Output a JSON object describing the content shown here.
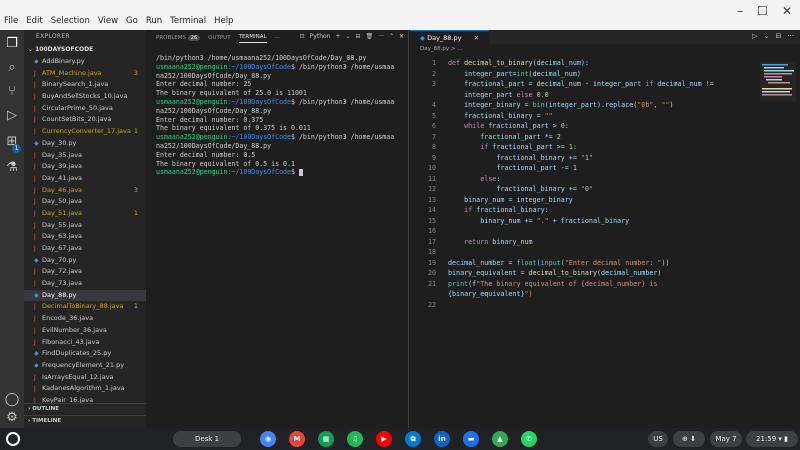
{
  "menu": [
    "File",
    "Edit",
    "Selection",
    "View",
    "Go",
    "Run",
    "Terminal",
    "Help"
  ],
  "window_controls": [
    "–",
    "☐",
    "✕"
  ],
  "sidebar": {
    "header": "EXPLORER",
    "folder": "100DAYSOFCODE",
    "files": [
      {
        "name": "AddBinary.py",
        "type": "py"
      },
      {
        "name": "ATM_Machine.java",
        "type": "java",
        "warn": true,
        "count": "3"
      },
      {
        "name": "BinarySearch_1.java",
        "type": "java"
      },
      {
        "name": "BuyAndSellStocks_10.java",
        "type": "java"
      },
      {
        "name": "CircularPrime_50.java",
        "type": "java"
      },
      {
        "name": "CountSetBits_20.java",
        "type": "java"
      },
      {
        "name": "CurrencyConverter_17.java",
        "type": "java",
        "warn": true,
        "count": "1"
      },
      {
        "name": "Day_30.py",
        "type": "py"
      },
      {
        "name": "Day_35.java",
        "type": "java"
      },
      {
        "name": "Day_39.java",
        "type": "java"
      },
      {
        "name": "Day_41.java",
        "type": "java"
      },
      {
        "name": "Day_46.java",
        "type": "java",
        "warn": true,
        "count": "3"
      },
      {
        "name": "Day_50.java",
        "type": "java"
      },
      {
        "name": "Day_51.java",
        "type": "java",
        "warn": true,
        "count": "1"
      },
      {
        "name": "Day_55.java",
        "type": "java"
      },
      {
        "name": "Day_63.java",
        "type": "java"
      },
      {
        "name": "Day_67.java",
        "type": "java"
      },
      {
        "name": "Day_70.py",
        "type": "py"
      },
      {
        "name": "Day_72.java",
        "type": "java"
      },
      {
        "name": "Day_73.java",
        "type": "java"
      },
      {
        "name": "Day_88.py",
        "type": "py",
        "selected": true
      },
      {
        "name": "DecimalToBinary_88.java",
        "type": "java",
        "warn": true,
        "count": "1"
      },
      {
        "name": "Encode_36.java",
        "type": "java"
      },
      {
        "name": "EvilNumber_36.java",
        "type": "java"
      },
      {
        "name": "Fibonacci_43.java",
        "type": "java"
      },
      {
        "name": "FindDuplicates_25.py",
        "type": "py"
      },
      {
        "name": "FrequencyElement_21.py",
        "type": "py"
      },
      {
        "name": "IsArraysEqual_12.java",
        "type": "java"
      },
      {
        "name": "KadanesAlgorithm_1.java",
        "type": "java"
      },
      {
        "name": "KeyPair_16.java",
        "type": "java"
      }
    ],
    "outline": "OUTLINE",
    "timeline": "TIMELINE"
  },
  "panel": {
    "tabs": {
      "problems": "PROBLEMS",
      "problems_count": "26",
      "output": "OUTPUT",
      "terminal": "TERMINAL",
      "more": "···"
    },
    "shell": "Python",
    "terminal_lines": [
      {
        "kind": "plain",
        "text": "/bin/python3 /home/usmaana252/100DaysOfCode/Day_88.py"
      },
      {
        "kind": "prompt",
        "user": "usmaana252@penguin",
        "path": ":~/100DaysOfCode",
        "cmd": "$ /bin/python3 /home/usmaa"
      },
      {
        "kind": "plain",
        "text": "na252/100DaysOfCode/Day_88.py"
      },
      {
        "kind": "plain",
        "text": "Enter decimal number: 25"
      },
      {
        "kind": "plain",
        "text": "The binary equivalent of 25.0 is 11001"
      },
      {
        "kind": "prompt",
        "user": "usmaana252@penguin",
        "path": ":~/100DaysOfCode",
        "cmd": "$ /bin/python3 /home/usmaa"
      },
      {
        "kind": "plain",
        "text": "na252/100DaysOfCode/Day_88.py"
      },
      {
        "kind": "plain",
        "text": "Enter decimal number: 0.375"
      },
      {
        "kind": "plain",
        "text": "The binary equivalent of 0.375 is 0.011"
      },
      {
        "kind": "prompt",
        "user": "usmaana252@penguin",
        "path": ":~/100DaysOfCode",
        "cmd": "$ /bin/python3 /home/usmaa"
      },
      {
        "kind": "plain",
        "text": "na252/100DaysOfCode/Day_88.py"
      },
      {
        "kind": "plain",
        "text": "Enter decimal number: 0.5"
      },
      {
        "kind": "plain",
        "text": "The binary equivalent of 0.5 is 0.1"
      },
      {
        "kind": "prompt",
        "user": "usmaana252@penguin",
        "path": ":~/100DaysOfCode",
        "cmd": "$ ",
        "cursor": true
      }
    ]
  },
  "editor": {
    "tab": "Day_88.py",
    "breadcrumb": "Day_88.py > ...",
    "lines": [
      {
        "n": "1",
        "t": "def decimal_to_binary(decimal_num):"
      },
      {
        "n": "2",
        "t": "    integer_part=int(decimal_num)"
      },
      {
        "n": "3",
        "t": "    fractional_part = decimal_num - integer_part if decimal_num !="
      },
      {
        "n": "",
        "t": "    integer_part else 0.0"
      },
      {
        "n": "4",
        "t": "    integer_binary = bin(integer_part).replace(\"0b\", \"\")"
      },
      {
        "n": "5",
        "t": "    fractional_binary = \"\""
      },
      {
        "n": "6",
        "t": "    while fractional_part > 0:"
      },
      {
        "n": "7",
        "t": "        fractional_part *= 2"
      },
      {
        "n": "8",
        "t": "        if fractional_part >= 1:"
      },
      {
        "n": "9",
        "t": "            fractional_binary += \"1\""
      },
      {
        "n": "10",
        "t": "            fractional_part -= 1"
      },
      {
        "n": "11",
        "t": "        else:"
      },
      {
        "n": "12",
        "t": "            fractional_binary += \"0\""
      },
      {
        "n": "13",
        "t": "    binary_num = integer_binary"
      },
      {
        "n": "14",
        "t": "    if fractional_binary:"
      },
      {
        "n": "15",
        "t": "        binary_num += \".\" + fractional_binary"
      },
      {
        "n": "16",
        "t": ""
      },
      {
        "n": "17",
        "t": "    return binary_num"
      },
      {
        "n": "18",
        "t": ""
      },
      {
        "n": "19",
        "t": "decimal_number = float(input(\"Enter decimal number: \"))"
      },
      {
        "n": "20",
        "t": "binary_equivalent = decimal_to_binary(decimal_number)"
      },
      {
        "n": "21",
        "t": "print(f\"The binary equivalent of {decimal_number} is"
      },
      {
        "n": "",
        "t": "{binary_equivalent}\")"
      },
      {
        "n": "22",
        "t": ""
      }
    ]
  },
  "shelf": {
    "desk": "Desk 1",
    "apps": [
      {
        "name": "chrome",
        "color": "#4285f4",
        "glyph": "◉"
      },
      {
        "name": "gmail",
        "color": "#ea4335",
        "glyph": "M"
      },
      {
        "name": "sheets",
        "color": "#0f9d58",
        "glyph": "▦"
      },
      {
        "name": "spotify",
        "color": "#1db954",
        "glyph": "♫"
      },
      {
        "name": "youtube",
        "color": "#ff0000",
        "glyph": "▶"
      },
      {
        "name": "vscode",
        "color": "#007acc",
        "glyph": "⧉"
      },
      {
        "name": "linkedin",
        "color": "#0a66c2",
        "glyph": "in"
      },
      {
        "name": "files",
        "color": "#1a73e8",
        "glyph": "▬"
      },
      {
        "name": "drive",
        "color": "#34a853",
        "glyph": "▲"
      },
      {
        "name": "whatsapp",
        "color": "#25d366",
        "glyph": "✆"
      }
    ],
    "locale": "US",
    "date": "May 7",
    "time": "21:59"
  }
}
